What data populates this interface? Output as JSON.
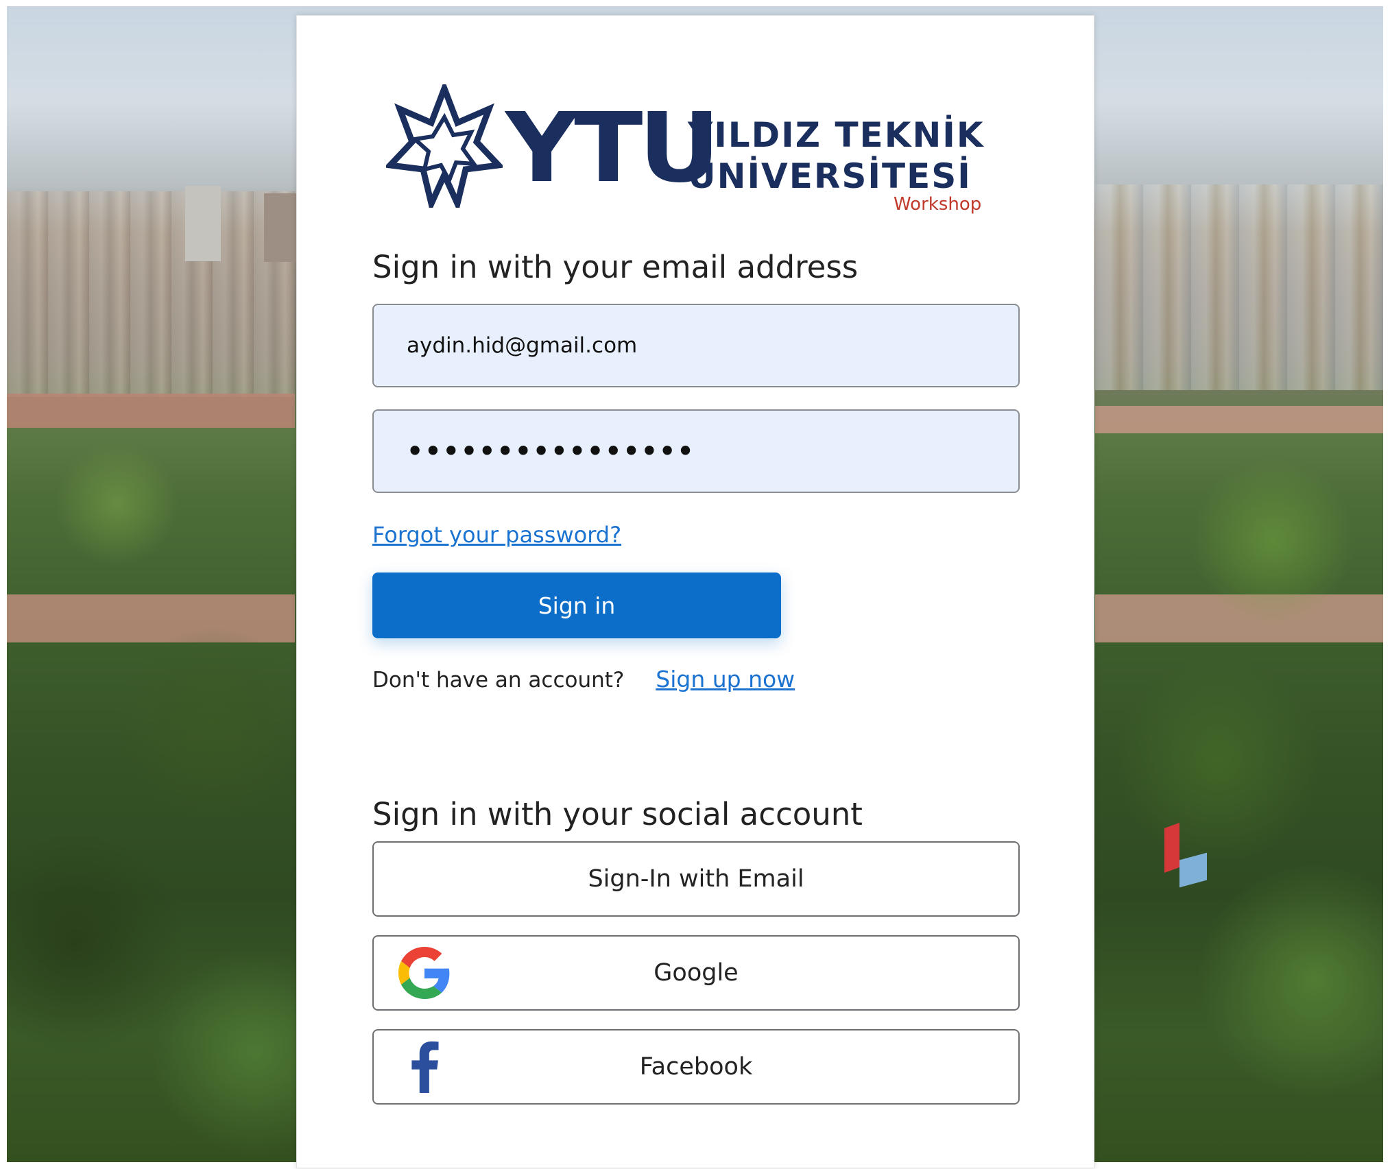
{
  "logo": {
    "mark": "YTU",
    "line1": "YILDIZ TEKNİK",
    "line2": "ÜNİVERSİTESİ",
    "tag": "Workshop"
  },
  "form": {
    "heading": "Sign in with your email address",
    "email_value": "aydin.hid@gmail.com",
    "password_value": "••••••••••••••••",
    "forgot_link": "Forgot your password?",
    "signin_button": "Sign in",
    "no_account_text": "Don't have an account?",
    "signup_link": "Sign up now"
  },
  "social": {
    "heading": "Sign in with your social account",
    "buttons": [
      {
        "label": "Sign-In with Email",
        "icon": ""
      },
      {
        "label": "Google",
        "icon": "google-icon"
      },
      {
        "label": "Facebook",
        "icon": "facebook-icon"
      }
    ]
  },
  "colors": {
    "primary": "#0d6ec9",
    "link": "#1b73d1",
    "brand_navy": "#1b2f5e",
    "workshop_red": "#c0392b",
    "input_fill": "#e8f0fe"
  }
}
